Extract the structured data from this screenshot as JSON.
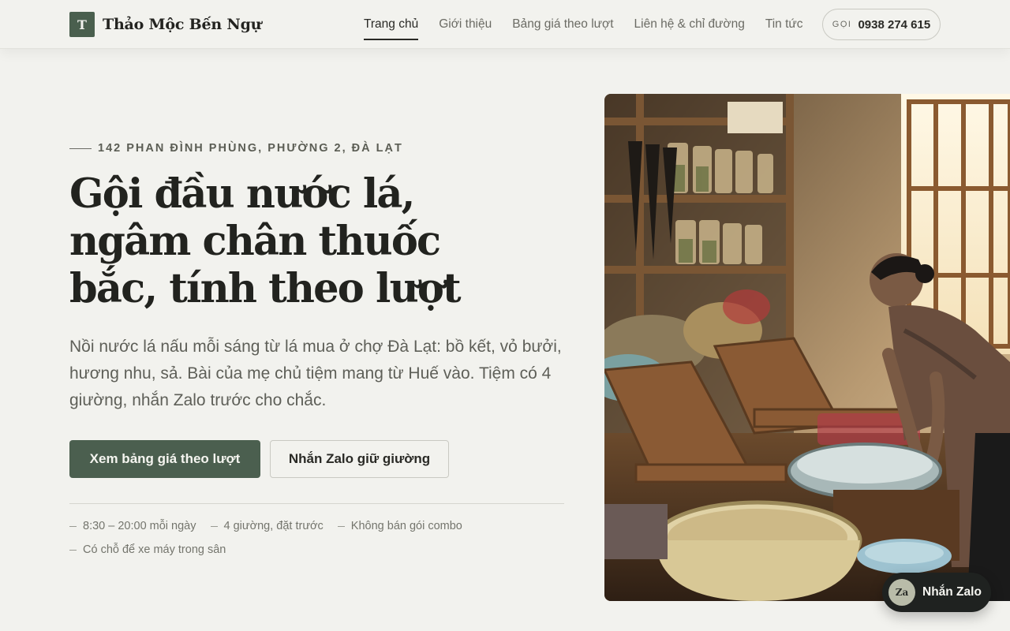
{
  "brand": {
    "mark": "T",
    "name": "Thảo Mộc Bến Ngự"
  },
  "nav": {
    "items": [
      {
        "label": "Trang chủ",
        "active": true
      },
      {
        "label": "Giới thiệu"
      },
      {
        "label": "Bảng giá theo lượt"
      },
      {
        "label": "Liên hệ & chỉ đường"
      },
      {
        "label": "Tin tức"
      }
    ],
    "call_label": "GỌI",
    "call_number": "0938 274 615"
  },
  "hero": {
    "eyebrow": "142 PHAN ĐÌNH PHÙNG, PHƯỜNG 2, ĐÀ LẠT",
    "title_lines": [
      "Gội đầu nước lá,",
      "ngâm chân thuốc",
      "bắc, tính theo lượt"
    ],
    "description": "Nồi nước lá nấu mỗi sáng từ lá mua ở chợ Đà Lạt: bồ kết, vỏ bưởi, hương nhu, sả. Bài của mẹ chủ tiệm mang từ Huế vào. Tiệm có 4 giường, nhắn Zalo trước cho chắc.",
    "primary_button": "Xem bảng giá theo lượt",
    "secondary_button": "Nhắn Zalo giữ giường",
    "facts": [
      "8:30 – 20:00 mỗi ngày",
      "4 giường, đặt trước",
      "Không bán gói combo",
      "Có chỗ để xe máy trong sân"
    ]
  },
  "zalo": {
    "badge": "Za",
    "label": "Nhắn Zalo"
  },
  "colors": {
    "background": "#f2f2ee",
    "accent": "#4b5f4f",
    "text": "#22231f",
    "muted": "#74756d",
    "float_button": "#1f2220"
  }
}
